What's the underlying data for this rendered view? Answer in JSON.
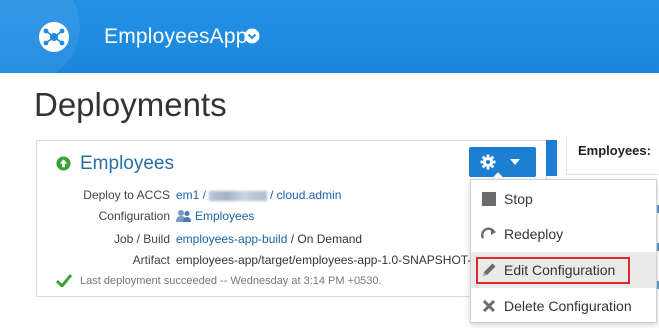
{
  "header": {
    "app_name": "EmployeesApp",
    "logo_icon": "app-logo-icon",
    "dropdown_icon": "chevron-down-circle-icon",
    "color": "#1d8be0"
  },
  "page": {
    "title": "Deployments"
  },
  "deployment": {
    "status_icon": "up-arrow-circle-icon",
    "name": "Employees",
    "rows": [
      {
        "label": "Deploy to ACCS",
        "value_parts": [
          "em1 /",
          "/ cloud.admin"
        ]
      },
      {
        "label": "Configuration",
        "value": "Employees"
      },
      {
        "label": "Job / Build",
        "link": "employees-app-build",
        "suffix": " / On Demand"
      },
      {
        "label": "Artifact",
        "value": "employees-app/target/employees-app-1.0-SNAPSHOT-"
      }
    ],
    "status_text": "Last deployment succeeded -- Wednesday at 3:14 PM +0530."
  },
  "actions_button": {
    "icon": "gear-icon",
    "caret_icon": "caret-down-icon"
  },
  "menu": {
    "items": [
      {
        "label": "Stop",
        "icon": "stop-icon"
      },
      {
        "label": "Redeploy",
        "icon": "redeploy-icon"
      },
      {
        "label": "Edit Configuration",
        "icon": "pencil-icon"
      },
      {
        "label": "Delete Configuration",
        "icon": "close-icon"
      }
    ]
  },
  "right_panel": {
    "title": "Employees:"
  },
  "colors": {
    "accent": "#1d7fd1",
    "link": "#1a63a8",
    "success": "#3aa335",
    "highlight_border": "#e0292d"
  }
}
